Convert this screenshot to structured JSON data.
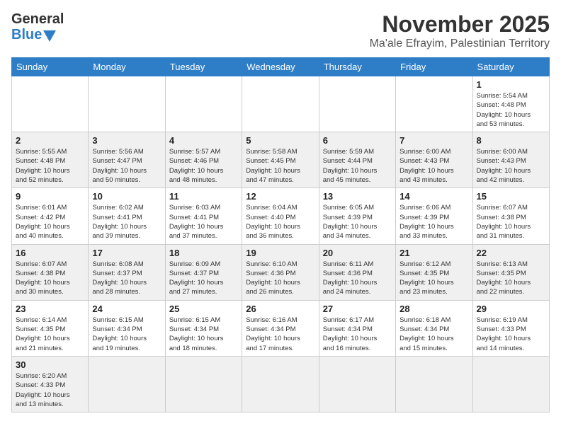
{
  "header": {
    "logo_general": "General",
    "logo_blue": "Blue",
    "title": "November 2025",
    "subtitle": "Ma'ale Efrayim, Palestinian Territory"
  },
  "weekdays": [
    "Sunday",
    "Monday",
    "Tuesday",
    "Wednesday",
    "Thursday",
    "Friday",
    "Saturday"
  ],
  "weeks": [
    [
      {
        "day": "",
        "info": ""
      },
      {
        "day": "",
        "info": ""
      },
      {
        "day": "",
        "info": ""
      },
      {
        "day": "",
        "info": ""
      },
      {
        "day": "",
        "info": ""
      },
      {
        "day": "",
        "info": ""
      },
      {
        "day": "1",
        "info": "Sunrise: 5:54 AM\nSunset: 4:48 PM\nDaylight: 10 hours\nand 53 minutes."
      }
    ],
    [
      {
        "day": "2",
        "info": "Sunrise: 5:55 AM\nSunset: 4:48 PM\nDaylight: 10 hours\nand 52 minutes."
      },
      {
        "day": "3",
        "info": "Sunrise: 5:56 AM\nSunset: 4:47 PM\nDaylight: 10 hours\nand 50 minutes."
      },
      {
        "day": "4",
        "info": "Sunrise: 5:57 AM\nSunset: 4:46 PM\nDaylight: 10 hours\nand 48 minutes."
      },
      {
        "day": "5",
        "info": "Sunrise: 5:58 AM\nSunset: 4:45 PM\nDaylight: 10 hours\nand 47 minutes."
      },
      {
        "day": "6",
        "info": "Sunrise: 5:59 AM\nSunset: 4:44 PM\nDaylight: 10 hours\nand 45 minutes."
      },
      {
        "day": "7",
        "info": "Sunrise: 6:00 AM\nSunset: 4:43 PM\nDaylight: 10 hours\nand 43 minutes."
      },
      {
        "day": "8",
        "info": "Sunrise: 6:00 AM\nSunset: 4:43 PM\nDaylight: 10 hours\nand 42 minutes."
      }
    ],
    [
      {
        "day": "9",
        "info": "Sunrise: 6:01 AM\nSunset: 4:42 PM\nDaylight: 10 hours\nand 40 minutes."
      },
      {
        "day": "10",
        "info": "Sunrise: 6:02 AM\nSunset: 4:41 PM\nDaylight: 10 hours\nand 39 minutes."
      },
      {
        "day": "11",
        "info": "Sunrise: 6:03 AM\nSunset: 4:41 PM\nDaylight: 10 hours\nand 37 minutes."
      },
      {
        "day": "12",
        "info": "Sunrise: 6:04 AM\nSunset: 4:40 PM\nDaylight: 10 hours\nand 36 minutes."
      },
      {
        "day": "13",
        "info": "Sunrise: 6:05 AM\nSunset: 4:39 PM\nDaylight: 10 hours\nand 34 minutes."
      },
      {
        "day": "14",
        "info": "Sunrise: 6:06 AM\nSunset: 4:39 PM\nDaylight: 10 hours\nand 33 minutes."
      },
      {
        "day": "15",
        "info": "Sunrise: 6:07 AM\nSunset: 4:38 PM\nDaylight: 10 hours\nand 31 minutes."
      }
    ],
    [
      {
        "day": "16",
        "info": "Sunrise: 6:07 AM\nSunset: 4:38 PM\nDaylight: 10 hours\nand 30 minutes."
      },
      {
        "day": "17",
        "info": "Sunrise: 6:08 AM\nSunset: 4:37 PM\nDaylight: 10 hours\nand 28 minutes."
      },
      {
        "day": "18",
        "info": "Sunrise: 6:09 AM\nSunset: 4:37 PM\nDaylight: 10 hours\nand 27 minutes."
      },
      {
        "day": "19",
        "info": "Sunrise: 6:10 AM\nSunset: 4:36 PM\nDaylight: 10 hours\nand 26 minutes."
      },
      {
        "day": "20",
        "info": "Sunrise: 6:11 AM\nSunset: 4:36 PM\nDaylight: 10 hours\nand 24 minutes."
      },
      {
        "day": "21",
        "info": "Sunrise: 6:12 AM\nSunset: 4:35 PM\nDaylight: 10 hours\nand 23 minutes."
      },
      {
        "day": "22",
        "info": "Sunrise: 6:13 AM\nSunset: 4:35 PM\nDaylight: 10 hours\nand 22 minutes."
      }
    ],
    [
      {
        "day": "23",
        "info": "Sunrise: 6:14 AM\nSunset: 4:35 PM\nDaylight: 10 hours\nand 21 minutes."
      },
      {
        "day": "24",
        "info": "Sunrise: 6:15 AM\nSunset: 4:34 PM\nDaylight: 10 hours\nand 19 minutes."
      },
      {
        "day": "25",
        "info": "Sunrise: 6:15 AM\nSunset: 4:34 PM\nDaylight: 10 hours\nand 18 minutes."
      },
      {
        "day": "26",
        "info": "Sunrise: 6:16 AM\nSunset: 4:34 PM\nDaylight: 10 hours\nand 17 minutes."
      },
      {
        "day": "27",
        "info": "Sunrise: 6:17 AM\nSunset: 4:34 PM\nDaylight: 10 hours\nand 16 minutes."
      },
      {
        "day": "28",
        "info": "Sunrise: 6:18 AM\nSunset: 4:34 PM\nDaylight: 10 hours\nand 15 minutes."
      },
      {
        "day": "29",
        "info": "Sunrise: 6:19 AM\nSunset: 4:33 PM\nDaylight: 10 hours\nand 14 minutes."
      }
    ],
    [
      {
        "day": "30",
        "info": "Sunrise: 6:20 AM\nSunset: 4:33 PM\nDaylight: 10 hours\nand 13 minutes."
      },
      {
        "day": "",
        "info": ""
      },
      {
        "day": "",
        "info": ""
      },
      {
        "day": "",
        "info": ""
      },
      {
        "day": "",
        "info": ""
      },
      {
        "day": "",
        "info": ""
      },
      {
        "day": "",
        "info": ""
      }
    ]
  ]
}
